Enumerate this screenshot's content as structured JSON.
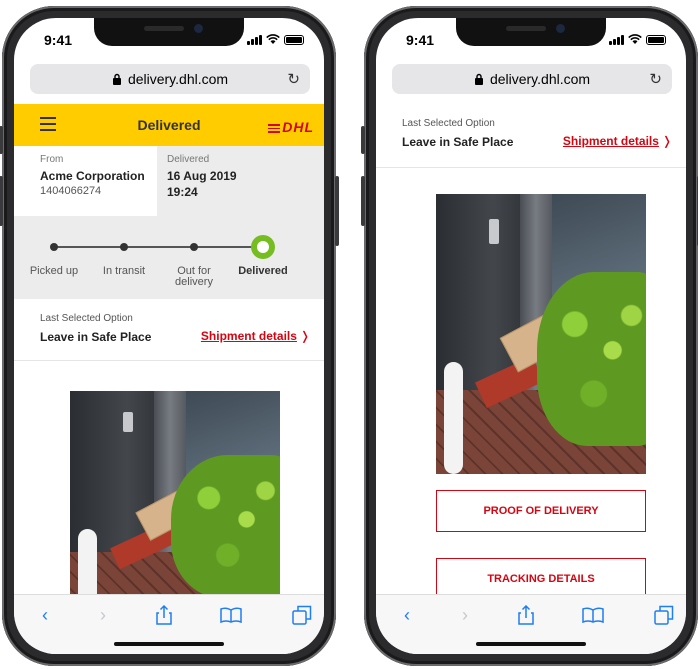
{
  "status_bar": {
    "time": "9:41"
  },
  "browser": {
    "url": "delivery.dhl.com",
    "reload_icon": "reload-icon",
    "lock_icon": "lock-icon"
  },
  "phone1": {
    "header": {
      "title": "Delivered",
      "logo": "DHL",
      "menu_icon": "hamburger-menu-icon"
    },
    "from": {
      "label": "From",
      "name": "Acme Corporation",
      "id": "1404066274"
    },
    "delivered": {
      "label": "Delivered",
      "date": "16 Aug 2019",
      "time": "19:24"
    },
    "steps": [
      {
        "label": "Picked up",
        "state": "done"
      },
      {
        "label": "In transit",
        "state": "done"
      },
      {
        "label": "Out for delivery",
        "state": "done"
      },
      {
        "label": "Delivered",
        "state": "current"
      }
    ],
    "selected_option": {
      "label": "Last Selected Option",
      "value": "Leave in Safe Place",
      "link": "Shipment details"
    }
  },
  "phone2": {
    "selected_option": {
      "label": "Last Selected Option",
      "value": "Leave in Safe Place",
      "link": "Shipment details"
    },
    "buttons": {
      "proof": "PROOF OF DELIVERY",
      "tracking": "TRACKING DETAILS"
    }
  },
  "toolbar": {
    "icons": [
      "back-icon",
      "forward-icon",
      "share-icon",
      "bookmarks-icon",
      "tabs-icon"
    ],
    "back_enabled": true,
    "forward_enabled": false
  },
  "colors": {
    "dhl_yellow": "#ffcc00",
    "dhl_red": "#d40511",
    "status_green": "#76bd22",
    "safari_blue": "#1f7ef2"
  }
}
